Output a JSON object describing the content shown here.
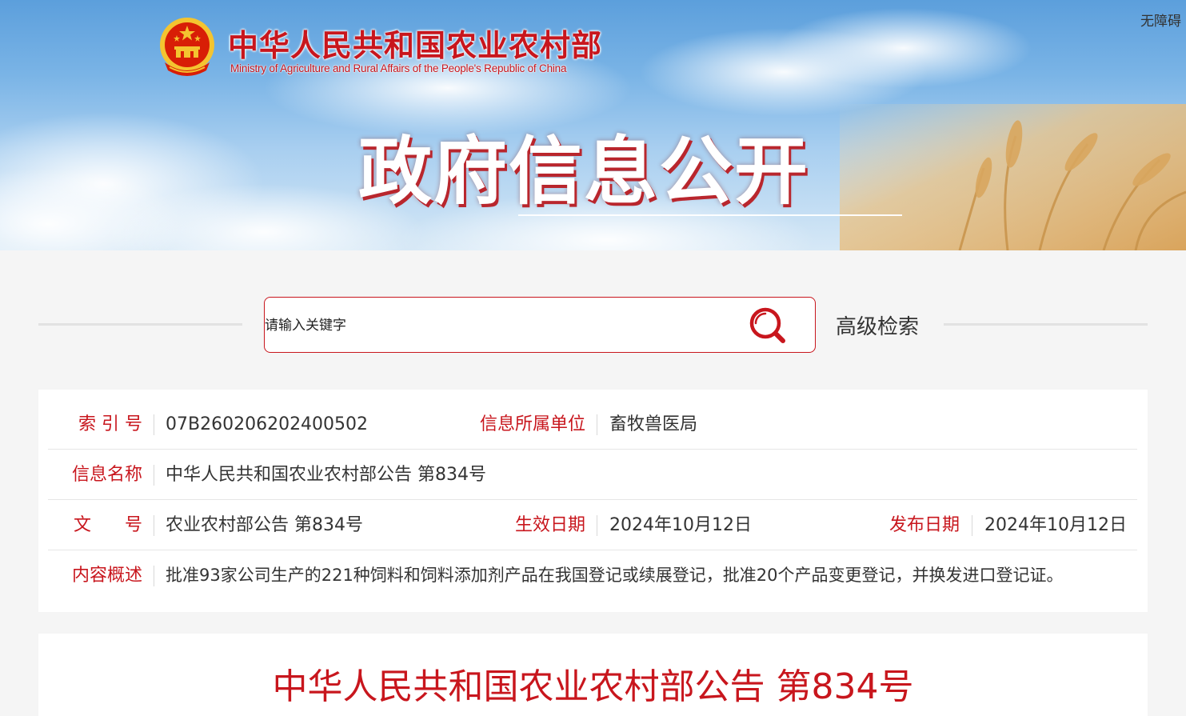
{
  "header": {
    "accessibility_label": "无障碍",
    "ministry_name_cn": "中华人民共和国农业农村部",
    "ministry_name_en": "Ministry of Agriculture and Rural Affairs of the People's Republic of China",
    "section_title": "政府信息公开"
  },
  "search": {
    "placeholder": "请输入关键字",
    "advanced_label": "高级检索"
  },
  "info": {
    "index_label": "索 引 号",
    "index_value": "07B260206202400502",
    "unit_label": "信息所属单位",
    "unit_value": "畜牧兽医局",
    "name_label": "信息名称",
    "name_value": "中华人民共和国农业农村部公告 第834号",
    "doc_no_label": "文      号",
    "doc_no_value": "农业农村部公告 第834号",
    "effective_label": "生效日期",
    "effective_value": "2024年10月12日",
    "publish_label": "发布日期",
    "publish_value": "2024年10月12日",
    "summary_label": "内容概述",
    "summary_value": "批准93家公司生产的221种饲料和饲料添加剂产品在我国登记或续展登记，批准20个产品变更登记，并换发进口登记证。"
  },
  "article": {
    "title": "中华人民共和国农业农村部公告 第834号"
  },
  "colors": {
    "accent": "#c8161d",
    "background": "#f5f5f5",
    "card": "#ffffff"
  },
  "icons": {
    "emblem": "national-emblem-icon",
    "search": "search-icon"
  }
}
